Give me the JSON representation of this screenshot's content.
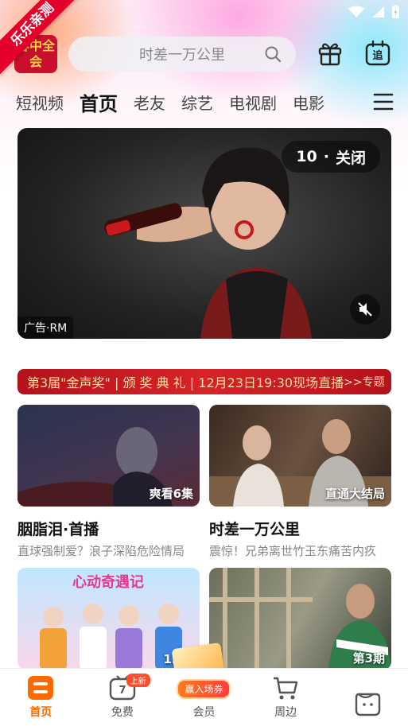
{
  "ribbon": {
    "text": "乐乐亲测"
  },
  "logo": {
    "text": "春中全会"
  },
  "search": {
    "placeholder": "时差一万公里"
  },
  "header": {
    "gift_icon": "gift-icon",
    "follow_label": "追"
  },
  "tabs": [
    {
      "label": "短视频",
      "active": false
    },
    {
      "label": "首页",
      "active": true
    },
    {
      "label": "老友",
      "active": false
    },
    {
      "label": "综艺",
      "active": false
    },
    {
      "label": "电视剧",
      "active": false
    },
    {
      "label": "电影",
      "active": false
    }
  ],
  "banner": {
    "countdown": "10",
    "close_label": "关闭",
    "ad_label": "广告·RM"
  },
  "promo": {
    "text": "第3届\"金声奖\" | 颁 奖 典 礼 | 12月23日19:30现场直播",
    "more": ">>专题"
  },
  "cards": [
    {
      "badge": "爽看6集",
      "title": "胭脂泪·首播",
      "subtitle": "直球强制爱？浪子深陷危险情局"
    },
    {
      "badge": "直通大结局",
      "title": "时差一万公里",
      "subtitle": "震惊！兄弟离世竹玉东痛苦内疚"
    }
  ],
  "cards2": [
    {
      "badge": "12-2",
      "art_text": "心动奇遇记"
    },
    {
      "badge": "第3期"
    }
  ],
  "bottom_nav": [
    {
      "label": "首页",
      "icon": "home-icon",
      "active": true
    },
    {
      "label": "免费",
      "icon": "tv-icon",
      "tag": "上新"
    },
    {
      "label": "会员",
      "icon": "vip-icon",
      "pill": "赢入场券"
    },
    {
      "label": "周边",
      "icon": "cart-icon"
    },
    {
      "label": "",
      "icon": "profile-icon"
    }
  ],
  "colors": {
    "accent": "#ff6a00",
    "promo_bg": "#d8232a",
    "ribbon": "#e4002b"
  }
}
